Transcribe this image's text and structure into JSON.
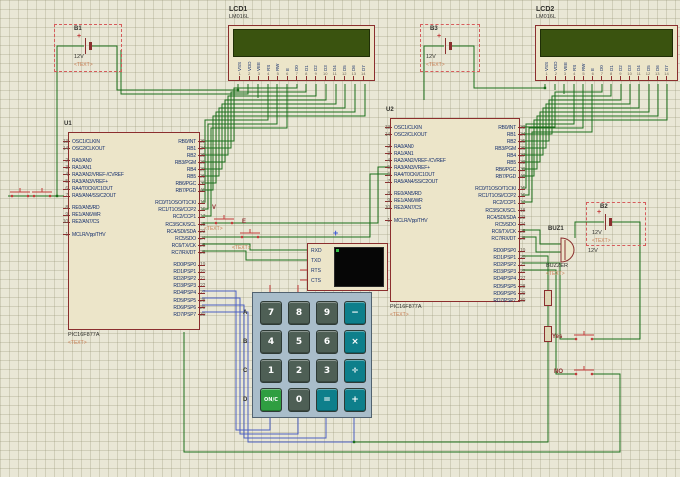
{
  "colors": {
    "background": "#e9e7d6",
    "grid": "#9a9478",
    "wire_green": "#1b6f1b",
    "wire_blue": "#4a5fc1",
    "pin_stub_red": "#8b2e2e",
    "component_fill": "#ece5c9",
    "component_outline": "#8b2e2e",
    "lcd_screen": "#3a530f",
    "keypad_body": "#a9bdca",
    "key_digit": "#4e5f55",
    "key_operator": "#0e7f8b",
    "key_on": "#2f9e41",
    "terminal_screen": "#060606",
    "placeholder_text": "#c77d52"
  },
  "b1": {
    "ref": "B1",
    "value": "12V",
    "text": "<TEXT>",
    "plus": "+"
  },
  "b2": {
    "ref": "B2",
    "value": "12V",
    "text": "<TEXT>",
    "plus": "+"
  },
  "b3": {
    "ref": "B3",
    "value": "12V",
    "text": "<TEXT>",
    "plus": "+"
  },
  "lcd1": {
    "ref": "LCD1",
    "model": "LM016L"
  },
  "lcd2": {
    "ref": "LCD2",
    "model": "LM016L"
  },
  "lcd_pins": [
    {
      "name": "VSS",
      "n": "1"
    },
    {
      "name": "VDD",
      "n": "2"
    },
    {
      "name": "VEE",
      "n": "3"
    },
    {
      "name": "RS",
      "n": "4"
    },
    {
      "name": "RW",
      "n": "5"
    },
    {
      "name": "E",
      "n": "6"
    },
    {
      "name": "D0",
      "n": "7"
    },
    {
      "name": "D1",
      "n": "8"
    },
    {
      "name": "D2",
      "n": "9"
    },
    {
      "name": "D3",
      "n": "10"
    },
    {
      "name": "D4",
      "n": "11"
    },
    {
      "name": "D5",
      "n": "12"
    },
    {
      "name": "D6",
      "n": "13"
    },
    {
      "name": "D7",
      "n": "14"
    }
  ],
  "u1": {
    "ref": "U1",
    "value": "PIC16F877A",
    "text": "<TEXT>"
  },
  "u2": {
    "ref": "U2",
    "value": "PIC16F877A",
    "text": "<TEXT>"
  },
  "pic_pins": {
    "left": [
      {
        "n": "13",
        "name": "OSC1/CLKIN"
      },
      {
        "n": "14",
        "name": "OSC2/CLKOUT"
      },
      {
        "n": "2",
        "name": "RA0/AN0",
        "cls": "gap"
      },
      {
        "n": "3",
        "name": "RA1/AN1"
      },
      {
        "n": "4",
        "name": "RA2/AN2/VREF-/CVREF"
      },
      {
        "n": "5",
        "name": "RA3/AN3/VREF+"
      },
      {
        "n": "6",
        "name": "RA4/T0CKI/C1OUT"
      },
      {
        "n": "7",
        "name": "RA5/AN4/SS/C2OUT"
      },
      {
        "n": "8",
        "name": "RE0/AN5/RD",
        "cls": "gap"
      },
      {
        "n": "9",
        "name": "RE1/AN6/WR"
      },
      {
        "n": "10",
        "name": "RE2/AN7/CS"
      },
      {
        "n": "1",
        "name": "MCLR/Vpp/THV",
        "cls": "gap"
      }
    ],
    "right": [
      {
        "n": "33",
        "name": "RB0/INT"
      },
      {
        "n": "34",
        "name": "RB1"
      },
      {
        "n": "35",
        "name": "RB2"
      },
      {
        "n": "36",
        "name": "RB3/PGM"
      },
      {
        "n": "37",
        "name": "RB4"
      },
      {
        "n": "38",
        "name": "RB5"
      },
      {
        "n": "39",
        "name": "RB6/PGC"
      },
      {
        "n": "40",
        "name": "RB7/PGD"
      },
      {
        "n": "15",
        "name": "RC0/T1OSO/T1CKI",
        "cls": "gap"
      },
      {
        "n": "16",
        "name": "RC1/T1OSI/CCP2"
      },
      {
        "n": "17",
        "name": "RC2/CCP1"
      },
      {
        "n": "18",
        "name": "RC3/SCK/SCL"
      },
      {
        "n": "23",
        "name": "RC4/SDI/SDA"
      },
      {
        "n": "24",
        "name": "RC5/SDO"
      },
      {
        "n": "25",
        "name": "RC6/TX/CK"
      },
      {
        "n": "26",
        "name": "RC7/RX/DT"
      },
      {
        "n": "19",
        "name": "RD0/PSP0",
        "cls": "gap"
      },
      {
        "n": "20",
        "name": "RD1/PSP1"
      },
      {
        "n": "21",
        "name": "RD2/PSP2"
      },
      {
        "n": "22",
        "name": "RD3/PSP3"
      },
      {
        "n": "27",
        "name": "RD4/PSP4"
      },
      {
        "n": "28",
        "name": "RD5/PSP5"
      },
      {
        "n": "29",
        "name": "RD6/PSP6"
      },
      {
        "n": "30",
        "name": "RD7/PSP7"
      }
    ]
  },
  "terminal": {
    "pins": [
      "RXD",
      "TXD",
      "RTS",
      "CTS"
    ],
    "marker": "+"
  },
  "keypad": {
    "row_labels": [
      "A",
      "B",
      "C",
      "D"
    ],
    "keys": [
      {
        "label": "7",
        "cls": "k-digit"
      },
      {
        "label": "8",
        "cls": "k-digit"
      },
      {
        "label": "9",
        "cls": "k-digit"
      },
      {
        "label": "−",
        "cls": "k-op"
      },
      {
        "label": "4",
        "cls": "k-digit"
      },
      {
        "label": "5",
        "cls": "k-digit"
      },
      {
        "label": "6",
        "cls": "k-digit"
      },
      {
        "label": "×",
        "cls": "k-op"
      },
      {
        "label": "1",
        "cls": "k-digit"
      },
      {
        "label": "2",
        "cls": "k-digit"
      },
      {
        "label": "3",
        "cls": "k-digit"
      },
      {
        "label": "÷",
        "cls": "k-op"
      },
      {
        "label": "ON/C",
        "cls": "k-on"
      },
      {
        "label": "0",
        "cls": "k-digit"
      },
      {
        "label": "=",
        "cls": "k-op"
      },
      {
        "label": "+",
        "cls": "k-op"
      }
    ]
  },
  "buzzer": {
    "ref": "BUZ1",
    "value": "12V",
    "type": "BUZZER",
    "text": "<TEXT>"
  },
  "labels": {
    "v": "V",
    "v_text": "<TEXT>",
    "e": "E",
    "e_text": "<TEXT>",
    "yes": "Yes",
    "no": "NO"
  }
}
